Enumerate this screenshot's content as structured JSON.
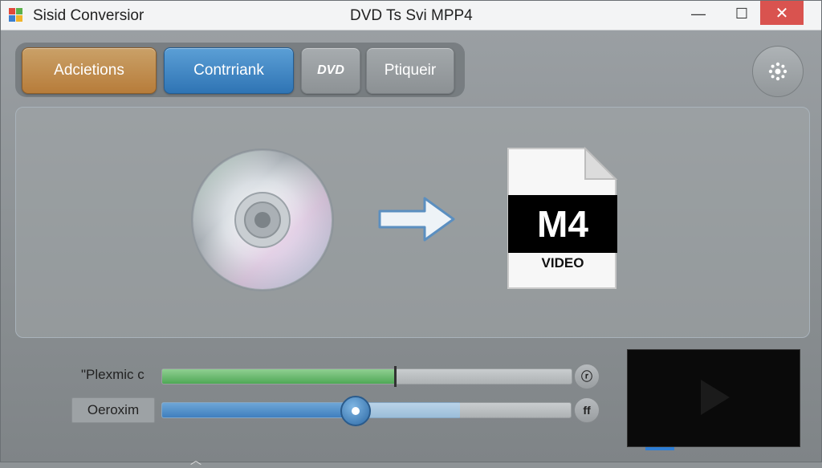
{
  "window": {
    "app_title": "Sisid Conversior",
    "doc_title": "DVD Ts Svi MPP4",
    "minimize_glyph": "—",
    "maximize_glyph": "☐",
    "close_glyph": "✕"
  },
  "toolbar": {
    "btn_addictions": "Adcietions",
    "btn_contrank": "Contrriank",
    "btn_dvd": "DVD",
    "btn_ptiquier": "Ptiqueir",
    "settings_icon": "gear-icon"
  },
  "conversion": {
    "source_icon": "dvd-disc-icon",
    "arrow_icon": "arrow-right-icon",
    "target_format": "M4",
    "target_label": "VIDEO"
  },
  "controls": {
    "slider1_label": "\"Plexmic c",
    "slider1_value": 0.57,
    "slider1_button": "ⓡ",
    "slider2_label": "Oeroxim",
    "slider2_value": 0.47,
    "slider2_button": "ff"
  },
  "preview": {
    "play_icon": "play-icon"
  },
  "colors": {
    "accent_orange": "#b77c3a",
    "accent_blue": "#2f74b4",
    "progress_green": "#4fa856",
    "close_red": "#d9534f"
  }
}
